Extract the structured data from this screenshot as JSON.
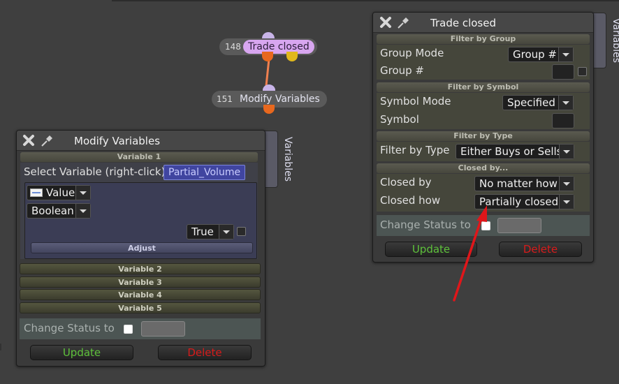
{
  "nodes": {
    "trade_closed": {
      "id": "148",
      "label": "Trade closed"
    },
    "modify_variables": {
      "id": "151",
      "label": "Modify Variables"
    }
  },
  "trade_panel": {
    "title": "Trade closed",
    "side_tab": "Variables",
    "group": {
      "header": "Filter by Group",
      "mode_label": "Group Mode",
      "mode_value": "Group #",
      "number_label": "Group #"
    },
    "symbol": {
      "header": "Filter by Symbol",
      "mode_label": "Symbol Mode",
      "mode_value": "Specified",
      "symbol_label": "Symbol"
    },
    "type": {
      "header": "Filter by Type",
      "filter_label": "Filter by Type",
      "filter_value": "Either Buys or Sells"
    },
    "closed": {
      "header": "Closed by...",
      "by_label": "Closed by",
      "by_value": "No matter how",
      "how_label": "Closed how",
      "how_value": "Partially closed"
    },
    "status_label": "Change Status to",
    "update": "Update",
    "delete": "Delete"
  },
  "modify_panel": {
    "title": "Modify Variables",
    "side_tab": "Variables",
    "variable1": {
      "header": "Variable 1",
      "select_label": "Select Variable (right-click)",
      "variable_name": "Partial_Volume",
      "source_value": "Value",
      "type_value": "Boolean",
      "bool_value": "True",
      "adjust": "Adjust"
    },
    "collapsed": [
      "Variable 2",
      "Variable 3",
      "Variable 4",
      "Variable 5"
    ],
    "status_label": "Change Status to",
    "update": "Update",
    "delete": "Delete"
  },
  "colors": {
    "update_text": "#5ec13b",
    "delete_text": "#d81b1b",
    "arrow": "#e0161a",
    "node_label": "#d8a6f0",
    "link": "#f08050"
  }
}
